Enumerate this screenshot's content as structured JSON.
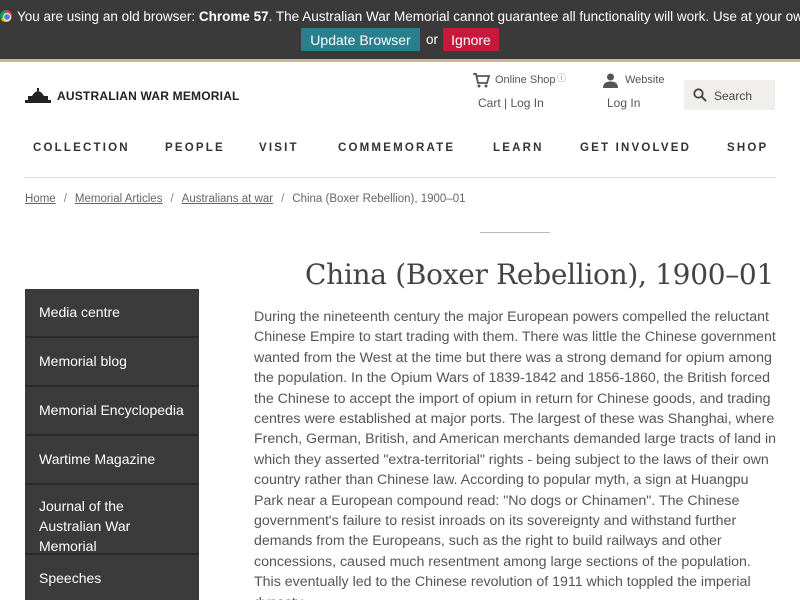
{
  "banner": {
    "prefix": "You are using an old browser:",
    "browser": "Chrome 57",
    "suffix": ". The Australian War Memorial cannot guarantee all functionality will work. Use at your own risk.",
    "update_label": "Update Browser",
    "or_label": "or",
    "ignore_label": "Ignore"
  },
  "header": {
    "logo_text": "AUSTRALIAN WAR MEMORIAL",
    "shop_label": "Online Shop",
    "shop_info": "ⓘ",
    "shop_sub": "Cart | Log In",
    "website_label": "Website",
    "website_sub": "Log In",
    "search_label": "Search"
  },
  "nav": [
    "COLLECTION",
    "PEOPLE",
    "VISIT",
    "COMMEMORATE",
    "LEARN",
    "GET INVOLVED",
    "SHOP"
  ],
  "breadcrumbs": [
    "Home",
    "Memorial Articles",
    "Australians at war",
    "China (Boxer Rebellion), 1900–01"
  ],
  "page_title": "China (Boxer Rebellion), 1900–01",
  "sidebar": [
    "Media centre",
    "Memorial blog",
    "Memorial Encyclopedia",
    "Wartime Magazine",
    "Journal of the Australian War Memorial",
    "Speeches"
  ],
  "body": "During the nineteenth century the major European powers compelled the reluctant Chinese Empire to start trading with them. There was little the Chinese government wanted from the West at the time but there was a strong demand for opium among the population. In the Opium Wars of 1839-1842 and 1856-1860, the British forced the Chinese to accept the import of opium in return for Chinese goods, and trading centres were established at major ports. The largest of these was Shanghai, where French, German, British, and American merchants demanded large tracts of land in which they asserted \"extra-territorial\" rights - being subject to the laws of their own country rather than Chinese law. According to popular myth, a sign at Huangpu Park near a European compound read: \"No dogs or Chinamen\". The Chinese government's failure to resist inroads on its sovereignty and withstand further demands from the Europeans, such as the right to build railways and other concessions, caused much resentment among large sections of the population. This eventually led to the Chinese revolution of 1911 which toppled the imperial dynasty."
}
